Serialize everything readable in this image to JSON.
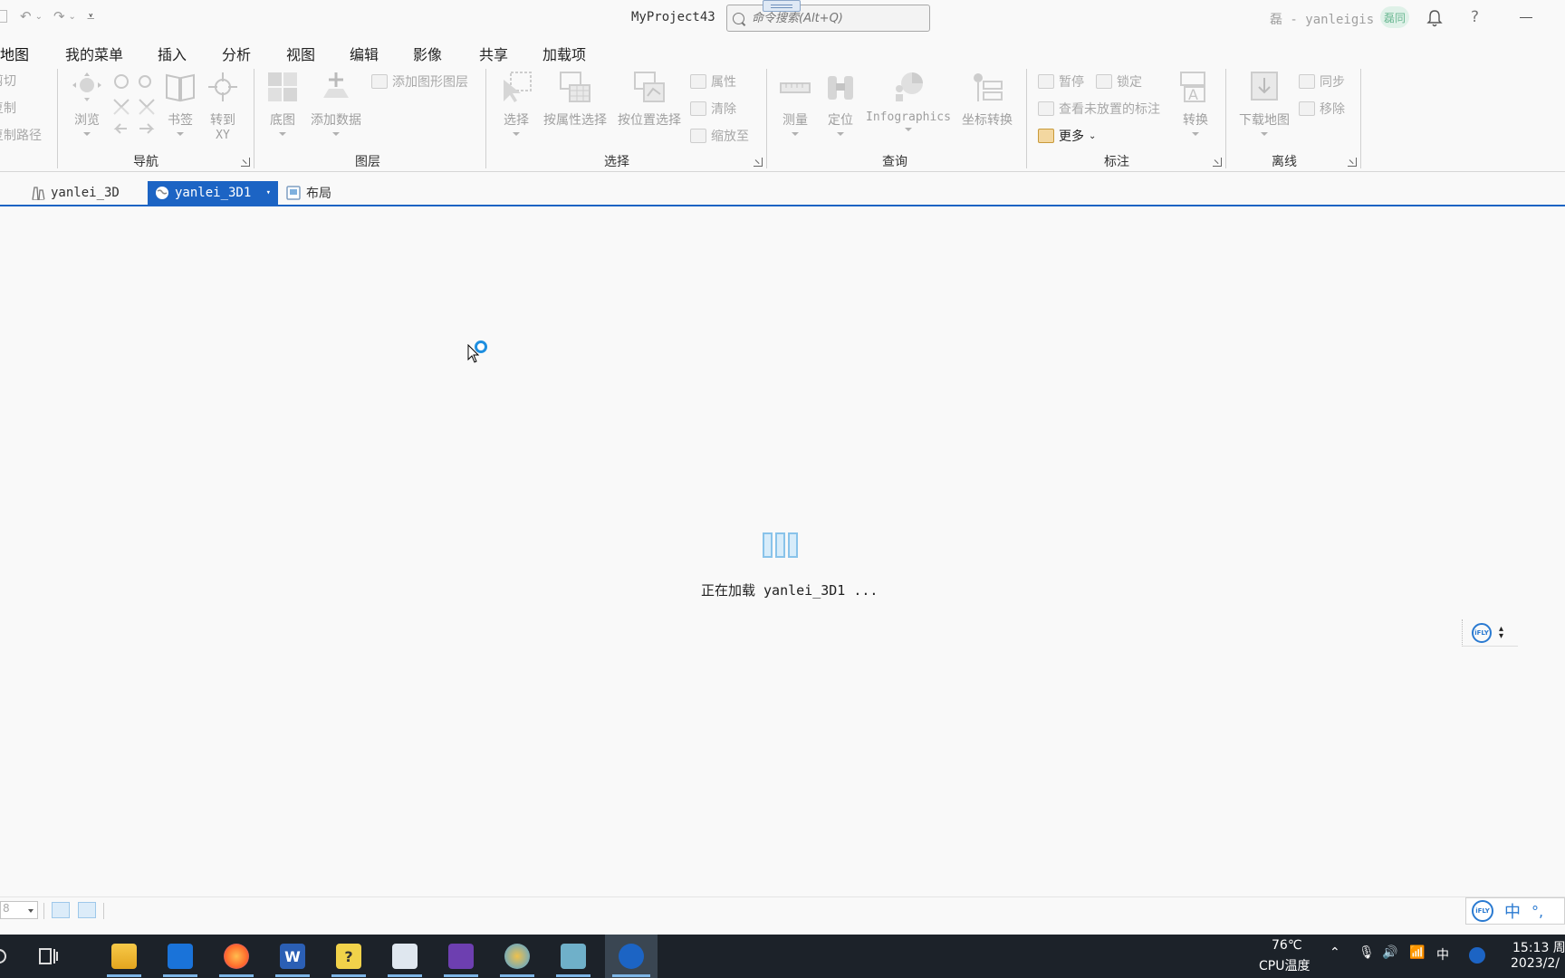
{
  "window": {
    "title": "MyProject43",
    "search_placeholder": "命令搜索(Alt+Q)",
    "user": "磊 - yanleigis",
    "user_badge": "磊同",
    "help": "?"
  },
  "ribbon_tabs": [
    "地图",
    "我的菜单",
    "插入",
    "分析",
    "视图",
    "编辑",
    "影像",
    "共享",
    "加载项"
  ],
  "clipboard": {
    "cut": "剪切",
    "copy": "复制",
    "copy_path": "复制路径"
  },
  "nav": {
    "label": "导航",
    "explore": "浏览",
    "bookmark": "书签",
    "goto_xy": "转到\nXY",
    "goto1": "转到",
    "goto2": "XY"
  },
  "layer": {
    "label": "图层",
    "basemap": "底图",
    "add_data": "添加数据",
    "add_graphics": "添加图形图层"
  },
  "selection": {
    "label": "选择",
    "select": "选择",
    "by_attr": "按属性选择",
    "by_loc": "按位置选择",
    "attributes": "属性",
    "clear": "清除",
    "zoom_to": "缩放至"
  },
  "inquiry": {
    "label": "查询",
    "measure": "测量",
    "locate": "定位",
    "infographics": "Infographics",
    "coord_convert": "坐标转换"
  },
  "labeling": {
    "label": "标注",
    "pause": "暂停",
    "lock": "锁定",
    "view_unplaced": "查看未放置的标注",
    "more": "更多",
    "convert": "转换"
  },
  "offline": {
    "label": "离线",
    "download_map": "下载地图",
    "sync": "同步",
    "remove": "移除"
  },
  "doc_tabs": [
    {
      "label": "yanlei_3D"
    },
    {
      "label": "yanlei_3D1"
    },
    {
      "label": "布局"
    }
  ],
  "loading": {
    "text": "正在加载 yanlei_3D1 ..."
  },
  "status": {
    "scale": "8"
  },
  "ime": {
    "logo": "iFLY",
    "mode": "中"
  },
  "tray": {
    "temp": "76℃",
    "temp_label": "CPU温度",
    "ime": "中",
    "time": "15:13 周",
    "date": "2023/2/"
  },
  "colors": {
    "accent": "#1c64c4",
    "taskbar": "#1c2229",
    "loader": "#89c3ea"
  }
}
